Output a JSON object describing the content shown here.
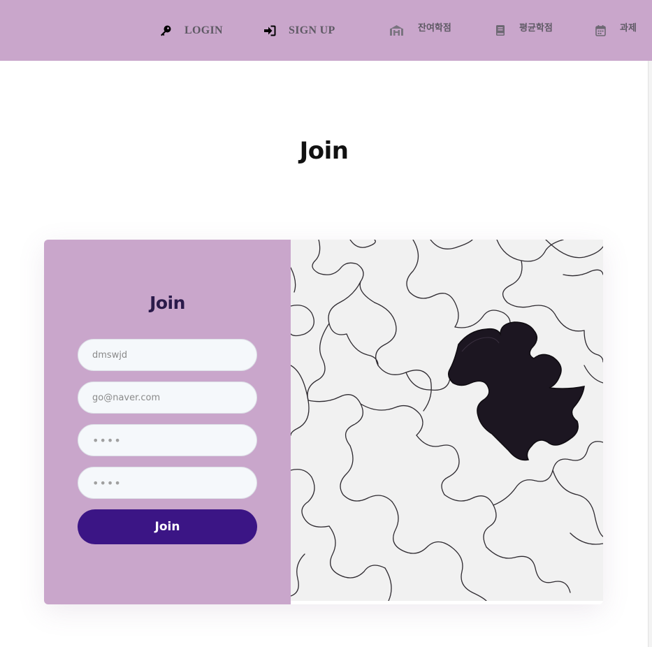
{
  "nav": {
    "items": [
      {
        "label": "LOGIN",
        "icon": "key-icon"
      },
      {
        "label": "SIGN UP",
        "icon": "sign-in-icon"
      },
      {
        "label": "잔여학점",
        "icon": "university-icon"
      },
      {
        "label": "평균학점",
        "icon": "book-icon"
      },
      {
        "label": "과제",
        "icon": "calendar-icon"
      }
    ]
  },
  "page": {
    "title": "Join"
  },
  "form": {
    "title": "Join",
    "fields": {
      "username_value": "dmswjd",
      "email_value": "go@naver.com",
      "password_value": "1234",
      "password_confirm_value": "1234"
    },
    "submit_label": "Join"
  },
  "image": {
    "subject": "puzzle-with-missing-piece",
    "colors": {
      "piece": "#f1f1f1",
      "hole": "#1c1621"
    }
  },
  "colors": {
    "navbar": "#c9a6cb",
    "form_panel": "#c9a6cb",
    "button": "#3b1585",
    "title": "#111111"
  }
}
